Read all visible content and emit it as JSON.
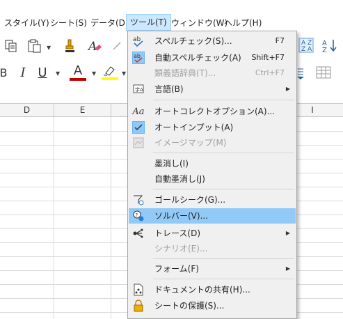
{
  "menubar": [
    {
      "label": "スタイル(Y)"
    },
    {
      "label": "シート(S)"
    },
    {
      "label": "データ(D)"
    },
    {
      "label": "ツール(T)"
    },
    {
      "label": "ウィンドウ(W)"
    },
    {
      "label": "ヘルプ(H)"
    }
  ],
  "toolbar": {
    "italic": "I",
    "underline": "U",
    "font_color": "A",
    "sort_az": "AZ",
    "sort_asc": "A↓"
  },
  "columns": [
    "D",
    "E",
    "I"
  ],
  "menu": {
    "items": [
      {
        "label": "スペルチェック(S)...",
        "shortcut": "F7",
        "icon": "spellcheck-icon",
        "state": "normal"
      },
      {
        "label": "自動スペルチェック(A)",
        "shortcut": "Shift+F7",
        "icon": "auto-spellcheck-icon",
        "state": "checked"
      },
      {
        "label": "類義語辞典(T)...",
        "shortcut": "Ctrl+F7",
        "icon": "",
        "state": "disabled"
      },
      {
        "label": "言語(B)",
        "shortcut": "",
        "icon": "language-icon",
        "state": "submenu"
      },
      {
        "label": "オートコレクトオプション(A)...",
        "shortcut": "",
        "icon": "autocorrect-icon",
        "state": "normal"
      },
      {
        "label": "オートインプット(A)",
        "shortcut": "",
        "icon": "checkmark-icon",
        "state": "checked"
      },
      {
        "label": "イメージマップ(M)",
        "shortcut": "",
        "icon": "image-map-icon",
        "state": "disabled"
      },
      {
        "label": "墨消し(I)",
        "shortcut": "",
        "icon": "",
        "state": "normal"
      },
      {
        "label": "自動墨消し(J)",
        "shortcut": "",
        "icon": "",
        "state": "normal"
      },
      {
        "label": "ゴールシーク(G)...",
        "shortcut": "",
        "icon": "goal-seek-icon",
        "state": "normal"
      },
      {
        "label": "ソルバー(V)...",
        "shortcut": "",
        "icon": "solver-icon",
        "state": "highlighted"
      },
      {
        "label": "トレース(D)",
        "shortcut": "",
        "icon": "trace-icon",
        "state": "submenu"
      },
      {
        "label": "シナリオ(E)...",
        "shortcut": "",
        "icon": "",
        "state": "disabled"
      },
      {
        "label": "フォーム(F)",
        "shortcut": "",
        "icon": "",
        "state": "submenu"
      },
      {
        "label": "ドキュメントの共有(H)...",
        "shortcut": "",
        "icon": "share-document-icon",
        "state": "normal"
      },
      {
        "label": "シートの保護(S)...",
        "shortcut": "",
        "icon": "protect-sheet-icon",
        "state": "normal"
      }
    ]
  },
  "colors": {
    "highlight": "#91c9f7",
    "menubar_active": "#cce8ff",
    "font_color_bar": "#c00000",
    "highlight_bar": "#ffff00"
  }
}
